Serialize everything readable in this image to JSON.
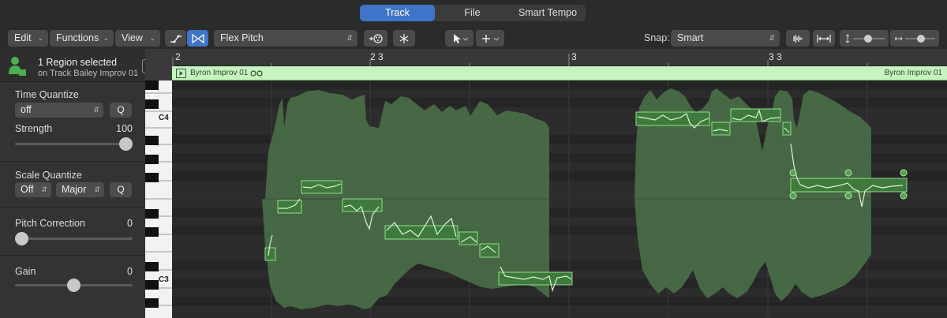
{
  "tabs": [
    {
      "label": "Track",
      "active": true
    },
    {
      "label": "File",
      "active": false
    },
    {
      "label": "Smart Tempo",
      "active": false
    }
  ],
  "toolbar": {
    "edit_label": "Edit",
    "functions_label": "Functions",
    "view_label": "View",
    "mode_value": "Flex Pitch",
    "snap_label": "Snap:",
    "snap_value": "Smart"
  },
  "inspector": {
    "selection_title": "1 Region selected",
    "selection_subtitle": "on Track Bailey Improv 01",
    "time_quantize": {
      "title": "Time Quantize",
      "value": "off",
      "q_label": "Q"
    },
    "strength": {
      "title": "Strength",
      "value": "100",
      "level": 1.0
    },
    "scale_quantize": {
      "title": "Scale Quantize",
      "mode": "Off",
      "scale": "Major",
      "q_label": "Q"
    },
    "pitch_correction": {
      "title": "Pitch Correction",
      "value": "0",
      "level": 0.0
    },
    "gain": {
      "title": "Gain",
      "value": "0",
      "level": 0.5
    }
  },
  "piano": {
    "c4_label": "C4",
    "c3_label": "C3"
  },
  "ruler": {
    "marks": [
      "2",
      "2 3",
      "3",
      "3 3"
    ]
  },
  "region": {
    "name_left": "Byron Improv 01",
    "name_right": "Byron Improv 01"
  },
  "colors": {
    "accent_blue": "#3f74c8",
    "region_header": "#c6f3c0",
    "waveform": "#4f7a4b",
    "note_fill": "#3f7a3c",
    "note_border": "#9ef09a",
    "pitch_curve": "#d8f5d4"
  }
}
